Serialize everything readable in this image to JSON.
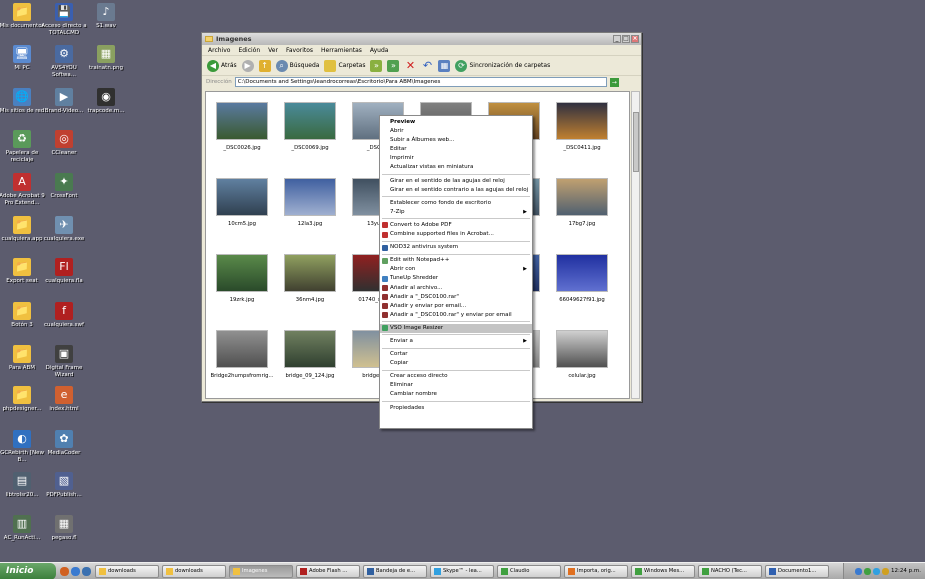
{
  "desktop_icons": [
    {
      "label": "Mis documentos",
      "color": "#f0c040",
      "glyph": "📁"
    },
    {
      "label": "Acceso directo a TOTALCMD",
      "color": "#3a5fb0",
      "glyph": "💾"
    },
    {
      "label": "S1.wav",
      "color": "#6a7a90",
      "glyph": "♪"
    },
    {
      "label": "Mi PC",
      "color": "#5a8ad0",
      "glyph": "🖥"
    },
    {
      "label": "AVS4YOU Softwa...",
      "color": "#4a6aa0",
      "glyph": "⚙"
    },
    {
      "label": "trainatn.png",
      "color": "#8aa060",
      "glyph": "▦"
    },
    {
      "label": "Mis sitios de red",
      "color": "#4a80c0",
      "glyph": "🌐"
    },
    {
      "label": "Brand-Video...",
      "color": "#6080a0",
      "glyph": "▶"
    },
    {
      "label": "trapcode.m...",
      "color": "#303030",
      "glyph": "◉"
    },
    {
      "label": "Papelera de reciclaje",
      "color": "#5a9a5a",
      "glyph": "♻"
    },
    {
      "label": "CCleaner",
      "color": "#c04030",
      "glyph": "◎"
    },
    {
      "label": "Adobe Acrobat 9 Pro Extend...",
      "color": "#c03030",
      "glyph": "A"
    },
    {
      "label": "CrossFont",
      "color": "#4a7a50",
      "glyph": "✦"
    },
    {
      "label": "cualquiera.app",
      "color": "#f0c040",
      "glyph": "📁"
    },
    {
      "label": "cualquiera.exe",
      "color": "#7090b0",
      "glyph": "✈"
    },
    {
      "label": "Export seat",
      "color": "#f0c040",
      "glyph": "📁"
    },
    {
      "label": "cualquiera.fla",
      "color": "#b02020",
      "glyph": "Fl"
    },
    {
      "label": "Botón 3",
      "color": "#f0c040",
      "glyph": "📁"
    },
    {
      "label": "cualquiera.swf",
      "color": "#b02020",
      "glyph": "f"
    },
    {
      "label": "Para ABM",
      "color": "#f0c040",
      "glyph": "📁"
    },
    {
      "label": "Digital Frame Wizard",
      "color": "#404040",
      "glyph": "▣"
    },
    {
      "label": "phpdesigner...",
      "color": "#f0c040",
      "glyph": "📁"
    },
    {
      "label": "index.html",
      "color": "#d06030",
      "glyph": "e"
    },
    {
      "label": "GCRebirth [New B...",
      "color": "#3070c0",
      "glyph": "◐"
    },
    {
      "label": "MediaCoder",
      "color": "#5080b0",
      "glyph": "✿"
    },
    {
      "label": "libtrolsr20...",
      "color": "#506070",
      "glyph": "▤"
    },
    {
      "label": "PDFPublish...",
      "color": "#506090",
      "glyph": "▧"
    },
    {
      "label": "AC_RunActi...",
      "color": "#507050",
      "glyph": "▥"
    },
    {
      "label": "pegaso.fl",
      "color": "#707070",
      "glyph": "▦"
    }
  ],
  "window": {
    "title": "Imagenes",
    "menu": [
      "Archivo",
      "Edición",
      "Ver",
      "Favoritos",
      "Herramientas",
      "Ayuda"
    ],
    "toolbar": {
      "back": "Atrás",
      "search": "Búsqueda",
      "folders": "Carpetas",
      "sync": "Sincronización de carpetas"
    },
    "address_label": "Dirección",
    "address_value": "C:\\Documents and Settings\\leandrocorreas\\Escritorio\\Para ABM\\Imagenes",
    "files": [
      {
        "name": "_DSC0026.jpg",
        "c1": "#5a7aa0",
        "c2": "#3a5a30"
      },
      {
        "name": "_DSC0069.jpg",
        "c1": "#4a8a9a",
        "c2": "#3a6a40"
      },
      {
        "name": "_DSC0...",
        "c1": "#a0b0c0",
        "c2": "#607080"
      },
      {
        "name": "",
        "c1": "#808080",
        "c2": "#505050"
      },
      {
        "name": "",
        "c1": "#c09040",
        "c2": "#604020"
      },
      {
        "name": "_DSC0411.jpg",
        "c1": "#303040",
        "c2": "#c08030"
      },
      {
        "name": "10cm5.jpg",
        "c1": "#6080a0",
        "c2": "#304050"
      },
      {
        "name": "12la3.jpg",
        "c1": "#4060a0",
        "c2": "#a0b0d0"
      },
      {
        "name": "13yu8...",
        "c1": "#405060",
        "c2": "#8090a0"
      },
      {
        "name": "",
        "c1": "#707070",
        "c2": "#404040"
      },
      {
        "name": "",
        "c1": "#7090a0",
        "c2": "#405060"
      },
      {
        "name": "17bg7.jpg",
        "c1": "#c0a070",
        "c2": "#506070"
      },
      {
        "name": "19zrk.jpg",
        "c1": "#5a8a4a",
        "c2": "#2a4a2a"
      },
      {
        "name": "36nm4.jpg",
        "c1": "#90a060",
        "c2": "#404030"
      },
      {
        "name": "01740_seat9...",
        "c1": "#902020",
        "c2": "#303030"
      },
      {
        "name": "",
        "c1": "#606060",
        "c2": "#303030"
      },
      {
        "name": "",
        "c1": "#4060a0",
        "c2": "#203060"
      },
      {
        "name": "66049627f91.jpg",
        "c1": "#2030a0",
        "c2": "#6070d0"
      },
      {
        "name": "Bridge2humpsfromrig...",
        "c1": "#909090",
        "c2": "#505050"
      },
      {
        "name": "bridge_09_124.jpg",
        "c1": "#708060",
        "c2": "#304030"
      },
      {
        "name": "bridge_21...",
        "c1": "#8090a0",
        "c2": "#d0c090"
      },
      {
        "name": "",
        "c1": "#a0a0a0",
        "c2": "#606060"
      },
      {
        "name": "",
        "c1": "#c0c0c0",
        "c2": "#808080"
      },
      {
        "name": "celular.jpg",
        "c1": "#d0d0d0",
        "c2": "#505050"
      }
    ]
  },
  "context_menu": [
    {
      "type": "item",
      "label": "Preview",
      "bold": true
    },
    {
      "type": "item",
      "label": "Abrir"
    },
    {
      "type": "item",
      "label": "Subir a Álbumes web..."
    },
    {
      "type": "item",
      "label": "Editar"
    },
    {
      "type": "item",
      "label": "Imprimir"
    },
    {
      "type": "item",
      "label": "Actualizar vistas en miniatura"
    },
    {
      "type": "sep"
    },
    {
      "type": "item",
      "label": "Girar en el sentido de las agujas del reloj"
    },
    {
      "type": "item",
      "label": "Girar en el sentido contrario a las agujas del reloj"
    },
    {
      "type": "sep"
    },
    {
      "type": "item",
      "label": "Establecer como fondo de escritorio"
    },
    {
      "type": "item",
      "label": "7-Zip",
      "submenu": true
    },
    {
      "type": "sep"
    },
    {
      "type": "item",
      "label": "Convert to Adobe PDF",
      "icon": "#c03030"
    },
    {
      "type": "item",
      "label": "Combine supported files in Acrobat...",
      "icon": "#c03030"
    },
    {
      "type": "sep"
    },
    {
      "type": "item",
      "label": "NOD32 antivirus system",
      "icon": "#3060a0"
    },
    {
      "type": "sep"
    },
    {
      "type": "item",
      "label": "Edit with Notepad++",
      "icon": "#60a060"
    },
    {
      "type": "item",
      "label": "Abrir con",
      "submenu": true
    },
    {
      "type": "item",
      "label": "TuneUp Shredder",
      "icon": "#4080c0"
    },
    {
      "type": "item",
      "label": "Añadir al archivo...",
      "icon": "#903030"
    },
    {
      "type": "item",
      "label": "Añadir a \"_DSC0100.rar\"",
      "icon": "#903030"
    },
    {
      "type": "item",
      "label": "Añadir y enviar por email...",
      "icon": "#903030"
    },
    {
      "type": "item",
      "label": "Añadir a \"_DSC0100.rar\" y enviar por email",
      "icon": "#903030"
    },
    {
      "type": "sep"
    },
    {
      "type": "item",
      "label": "VSO Image Resizer",
      "icon": "#40a060",
      "highlight": true
    },
    {
      "type": "sep"
    },
    {
      "type": "item",
      "label": "Enviar a",
      "submenu": true
    },
    {
      "type": "sep"
    },
    {
      "type": "item",
      "label": "Cortar"
    },
    {
      "type": "item",
      "label": "Copiar"
    },
    {
      "type": "sep"
    },
    {
      "type": "item",
      "label": "Crear acceso directo"
    },
    {
      "type": "item",
      "label": "Eliminar"
    },
    {
      "type": "item",
      "label": "Cambiar nombre"
    },
    {
      "type": "sep"
    },
    {
      "type": "item",
      "label": "Propiedades"
    }
  ],
  "taskbar": {
    "start": "Inicio",
    "buttons": [
      {
        "label": "downloads",
        "color": "#f0c040"
      },
      {
        "label": "downloads",
        "color": "#f0c040"
      },
      {
        "label": "Imagenes",
        "color": "#f0c040",
        "active": true
      },
      {
        "label": "Adobe Flash ...",
        "color": "#b02020"
      },
      {
        "label": "Bandeja de e...",
        "color": "#3060a0"
      },
      {
        "label": "Skype™ - lea...",
        "color": "#30a0e0"
      },
      {
        "label": "Claudio",
        "color": "#40a040"
      },
      {
        "label": "Importa, orig...",
        "color": "#e07020"
      },
      {
        "label": "Windows Mes...",
        "color": "#40a040"
      },
      {
        "label": "NACHO (Tec...",
        "color": "#40a040"
      },
      {
        "label": "Documento1...",
        "color": "#3060b0"
      }
    ],
    "clock": "12:24 p.m."
  }
}
